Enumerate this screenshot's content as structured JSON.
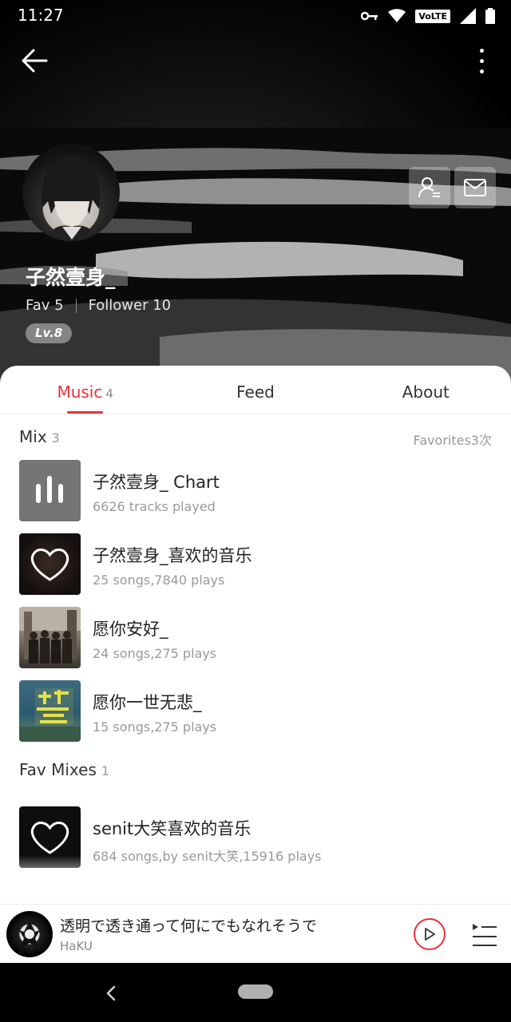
{
  "status_bar": {
    "time": "11:27",
    "volte": "VoLTE"
  },
  "profile": {
    "name": "子然壹身_",
    "fav_label": "Fav 5",
    "follower_label": "Follower 10",
    "level": "Lv.8"
  },
  "tabs": [
    {
      "label": "Music",
      "count": "4"
    },
    {
      "label": "Feed",
      "count": ""
    },
    {
      "label": "About",
      "count": ""
    }
  ],
  "mix_section": {
    "title": "Mix",
    "count": "3",
    "right_label": "Favorites3次",
    "items": [
      {
        "title": "子然壹身_ Chart",
        "subtitle": "6626 tracks played",
        "cover": "chart-icon"
      },
      {
        "title": "子然壹身_喜欢的音乐",
        "subtitle": "25 songs,7840 plays",
        "cover": "heart-icon"
      },
      {
        "title": "愿你安好_",
        "subtitle": "24 songs,275 plays",
        "cover": "band-photo"
      },
      {
        "title": "愿你一世无悲_",
        "subtitle": "15 songs,275 plays",
        "cover": "album-art"
      }
    ]
  },
  "fav_section": {
    "title": "Fav Mixes",
    "count": "1",
    "items": [
      {
        "title": "senit大笑喜欢的音乐",
        "subtitle": "684 songs,by senit大笑,15916 plays",
        "cover": "heart-icon"
      }
    ]
  },
  "mini_player": {
    "title": "透明で透き通って何にでもなれそうで",
    "artist": "HaKU"
  },
  "colors": {
    "accent": "#e8323c"
  }
}
